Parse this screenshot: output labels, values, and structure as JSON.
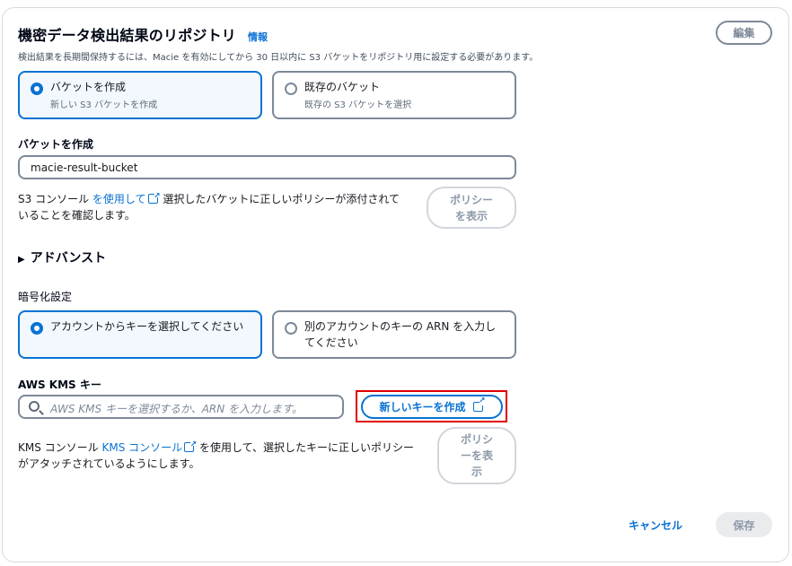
{
  "header": {
    "title": "機密データ検出結果のリポジトリ",
    "info_link": "情報",
    "description": "検出結果を長期間保持するには、Macie を有効にしてから 30 日以内に S3 バケットをリポジトリ用に設定する必要があります。",
    "edit_label": "編集"
  },
  "bucket_choice": {
    "options": [
      {
        "label": "バケットを作成",
        "sub": "新しい S3 バケットを作成",
        "selected": true
      },
      {
        "label": "既存のバケット",
        "sub": "既存の S3 バケットを選択",
        "selected": false
      }
    ]
  },
  "create_bucket": {
    "label": "バケットを作成",
    "value": "macie-result-bucket"
  },
  "s3_help": {
    "prefix": "S3 コンソール ",
    "link": "を使用して",
    "suffix_line1": " 選択したバケットに正しいポリシーが添付されて",
    "line2": "いることを確認します。",
    "policy_button_line1": "ポリシー",
    "policy_button_line2": "を表示"
  },
  "advanced": {
    "label": "アドバンスト"
  },
  "encryption": {
    "label": "暗号化設定",
    "options": [
      {
        "label": "アカウントからキーを選択してください",
        "selected": true
      },
      {
        "label_line1": "別のアカウントのキーの ARN を入力し",
        "label_line2": "てください",
        "selected": false
      }
    ]
  },
  "kms": {
    "label": "AWS KMS キー",
    "placeholder": "AWS KMS キーを選択するか、ARN を入力します。",
    "create_button": "新しいキーを作成",
    "help_prefix": "KMS コンソール ",
    "help_link": "KMS コンソール",
    "help_suffix_line1": " を使用して、選択したキーに正しいポリシー",
    "help_line2": "がアタッチされているようにします。",
    "policy_button_line1": "ポリシ",
    "policy_button_line2": "ーを表",
    "policy_button_line3": "示"
  },
  "footer": {
    "cancel_label": "キャンセル",
    "save_label": "保存"
  },
  "colors": {
    "accent": "#0972d3",
    "highlight": "#e00000"
  }
}
